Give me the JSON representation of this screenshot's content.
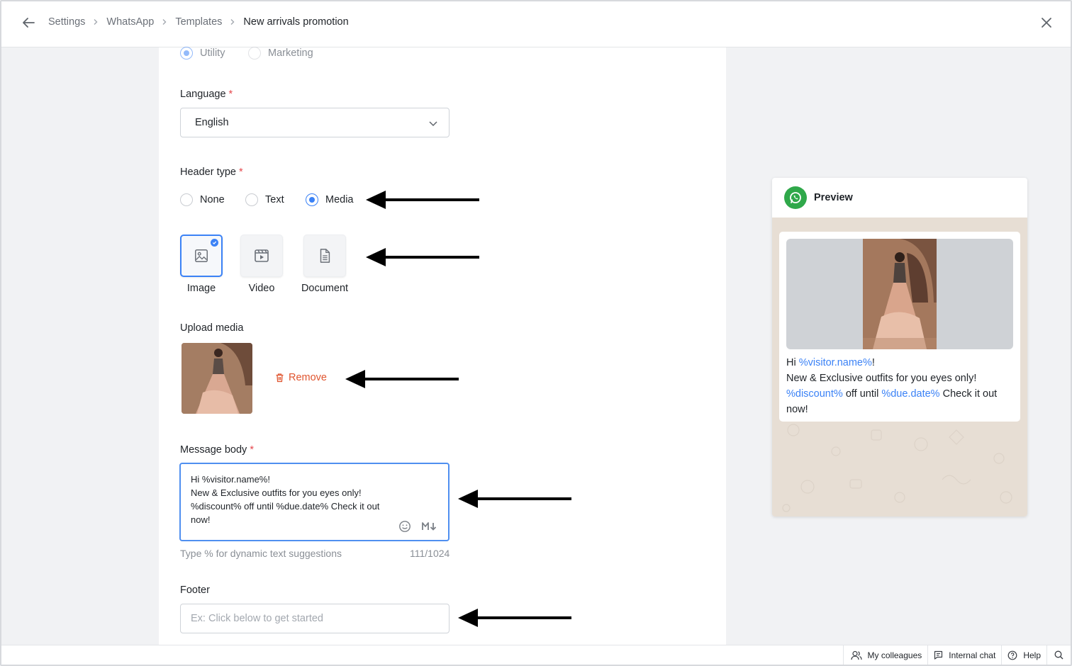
{
  "breadcrumb": {
    "items": [
      "Settings",
      "WhatsApp",
      "Templates"
    ],
    "current": "New arrivals promotion"
  },
  "category": {
    "options": [
      "Utility",
      "Marketing"
    ],
    "selected": "Utility"
  },
  "language": {
    "label": "Language",
    "required_mark": "*",
    "value": "English"
  },
  "header_type": {
    "label": "Header type",
    "required_mark": "*",
    "options": [
      "None",
      "Text",
      "Media"
    ],
    "selected": "Media"
  },
  "media_types": {
    "options": [
      "Image",
      "Video",
      "Document"
    ],
    "selected": "Image"
  },
  "upload_media": {
    "label": "Upload media",
    "remove_label": "Remove"
  },
  "message_body": {
    "label": "Message body",
    "required_mark": "*",
    "lines": [
      "Hi %visitor.name%!",
      "New & Exclusive outfits for you eyes only!",
      "%discount% off until %due.date% Check it out",
      "now!"
    ],
    "helper": "Type % for dynamic text suggestions",
    "counter": "111/1024"
  },
  "footer": {
    "label": "Footer",
    "placeholder": "Ex: Click below to get started",
    "value": ""
  },
  "preview": {
    "title": "Preview",
    "text": {
      "hi": "Hi ",
      "visitor_var": "%visitor.name%",
      "excl": "!",
      "line2": "New & Exclusive outfits for you eyes only!",
      "discount_var": "%discount%",
      "off_until": " off until ",
      "due_var": "%due.date%",
      "check": " Check it out now!"
    }
  },
  "bottom_bar": {
    "colleagues": "My colleagues",
    "internal_chat": "Internal chat",
    "help": "Help"
  },
  "colors": {
    "accent": "#3b82f6",
    "remove": "#e0552f",
    "whatsapp": "#2fa84a",
    "required": "#e5484d"
  }
}
